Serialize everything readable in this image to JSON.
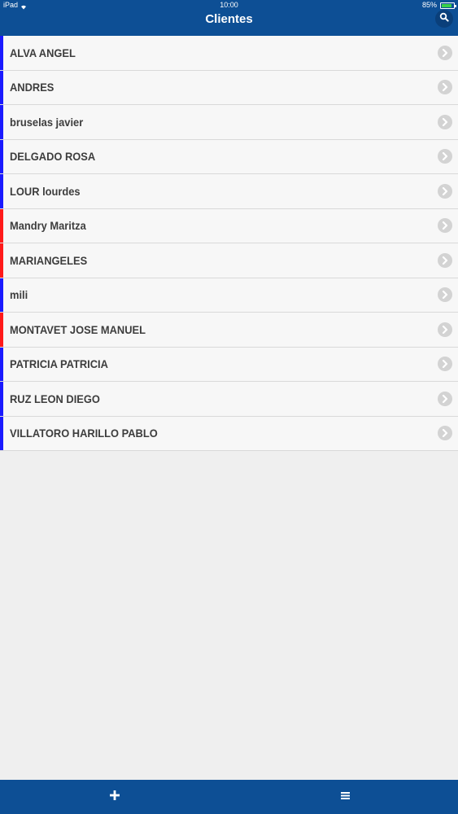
{
  "status_bar": {
    "device": "iPad",
    "time": "10:00",
    "battery": "85%",
    "battery_level": 0.85,
    "wifi_icon": "wifi-icon",
    "battery_icon": "battery-icon"
  },
  "nav": {
    "title": "Clientes",
    "search_icon": "search-icon",
    "color": "#0d4f95"
  },
  "clients": [
    {
      "name": "ALVA ANGEL",
      "color": "#1a1aff"
    },
    {
      "name": "ANDRES",
      "color": "#1a1aff"
    },
    {
      "name": "bruselas javier",
      "color": "#1a1aff"
    },
    {
      "name": "DELGADO ROSA",
      "color": "#1a1aff"
    },
    {
      "name": "LOUR lourdes",
      "color": "#1a1aff"
    },
    {
      "name": "Mandry Maritza",
      "color": "#ff1a1a"
    },
    {
      "name": "MARIANGELES",
      "color": "#ff1a1a"
    },
    {
      "name": "mili",
      "color": "#1a1aff"
    },
    {
      "name": "MONTAVET JOSE MANUEL",
      "color": "#ff1a1a"
    },
    {
      "name": "PATRICIA PATRICIA",
      "color": "#1a1aff"
    },
    {
      "name": "RUZ LEON DIEGO",
      "color": "#1a1aff"
    },
    {
      "name": "VILLATORO HARILLO PABLO",
      "color": "#1a1aff"
    }
  ],
  "row_icon": "chevron-right-icon",
  "toolbar": {
    "add_icon": "plus-icon",
    "menu_icon": "menu-icon"
  }
}
